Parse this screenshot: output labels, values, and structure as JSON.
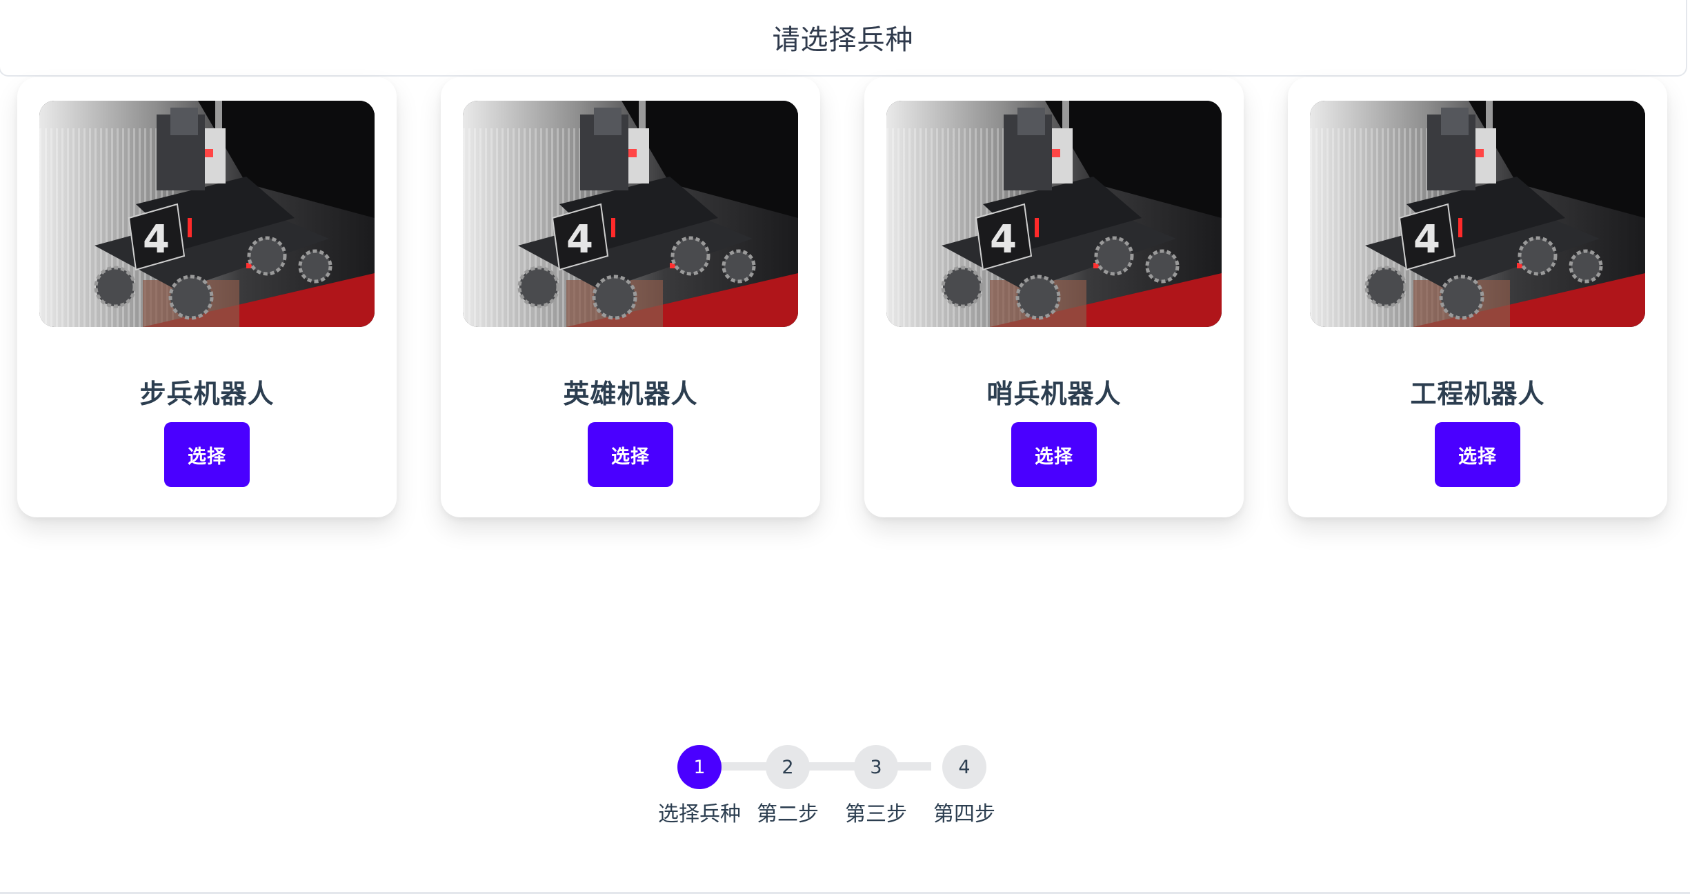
{
  "header": {
    "title": "请选择兵种"
  },
  "cards": [
    {
      "title": "步兵机器人",
      "button_label": "选择",
      "image_icon": "robot-photo"
    },
    {
      "title": "英雄机器人",
      "button_label": "选择",
      "image_icon": "robot-photo"
    },
    {
      "title": "哨兵机器人",
      "button_label": "选择",
      "image_icon": "robot-photo"
    },
    {
      "title": "工程机器人",
      "button_label": "选择",
      "image_icon": "robot-photo"
    }
  ],
  "stepper": {
    "current_step": 1,
    "steps": [
      {
        "number": "1",
        "label": "选择兵种"
      },
      {
        "number": "2",
        "label": "第二步"
      },
      {
        "number": "3",
        "label": "第三步"
      },
      {
        "number": "4",
        "label": "第四步"
      }
    ]
  },
  "colors": {
    "accent": "#4a00ff",
    "inactive_step": "#e6e7e9",
    "text": "#2c3e50"
  }
}
